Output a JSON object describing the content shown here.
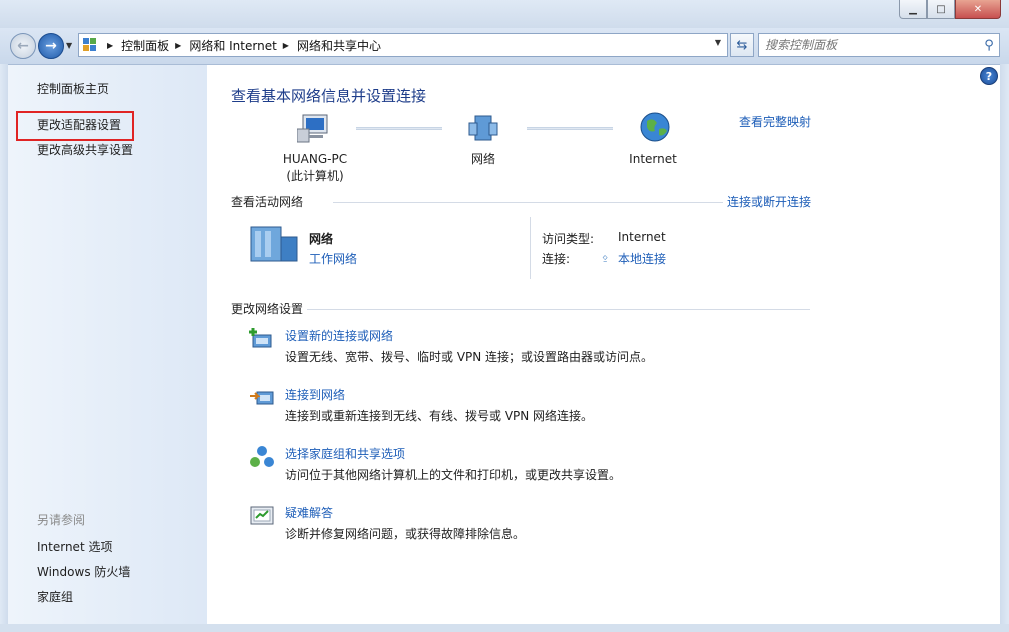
{
  "window": {
    "minimize": "▁",
    "maximize": "□",
    "close": "✕"
  },
  "nav": {
    "breadcrumbs": [
      "控制面板",
      "网络和 Internet",
      "网络和共享中心"
    ],
    "search_placeholder": "搜索控制面板",
    "icons": {
      "back": "back-arrow-icon",
      "forward": "forward-arrow-icon",
      "refresh": "refresh-icon",
      "search": "search-icon"
    }
  },
  "sidebar": {
    "items": [
      {
        "label": "控制面板主页"
      },
      {
        "label": "更改适配器设置"
      },
      {
        "label": "更改高级共享设置"
      }
    ],
    "see_also_title": "另请参阅",
    "see_also": [
      {
        "label": "Internet 选项"
      },
      {
        "label": "Windows 防火墙"
      },
      {
        "label": "家庭组"
      }
    ]
  },
  "main": {
    "title": "查看基本网络信息并设置连接",
    "view_full_map": "查看完整映射",
    "map": {
      "computer_name": "HUANG-PC",
      "computer_sub": "(此计算机)",
      "network": "网络",
      "internet": "Internet"
    },
    "active_section": {
      "title": "查看活动网络",
      "action_link": "连接或断开连接",
      "network_name": "网络",
      "network_type": "工作网络",
      "access_type_label": "访问类型:",
      "access_type_value": "Internet",
      "connection_label": "连接:",
      "connection_value": "本地连接"
    },
    "change_section": {
      "title": "更改网络设置",
      "tasks": [
        {
          "title": "设置新的连接或网络",
          "desc": "设置无线、宽带、拨号、临时或 VPN 连接；或设置路由器或访问点。",
          "icon": "new-connection-icon"
        },
        {
          "title": "连接到网络",
          "desc": "连接到或重新连接到无线、有线、拨号或 VPN 网络连接。",
          "icon": "connect-network-icon"
        },
        {
          "title": "选择家庭组和共享选项",
          "desc": "访问位于其他网络计算机上的文件和打印机，或更改共享设置。",
          "icon": "homegroup-icon"
        },
        {
          "title": "疑难解答",
          "desc": "诊断并修复网络问题，或获得故障排除信息。",
          "icon": "troubleshoot-icon"
        }
      ]
    }
  },
  "colors": {
    "link": "#1e5eb8",
    "title": "#1e3d8a",
    "sidebar_bg": "#e6eef9",
    "highlight_border": "#e02424"
  }
}
